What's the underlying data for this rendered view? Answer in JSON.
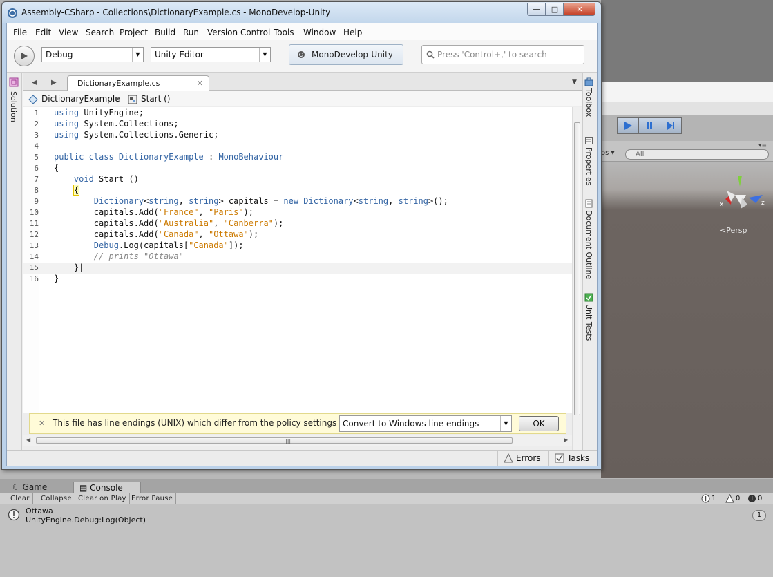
{
  "unity": {
    "scene": {
      "gizmo_dropdown": "os ▾",
      "search_placeholder": "All",
      "pane_menu": "▾≡",
      "persp_label": "Persp",
      "gizmo_axis_x": "x",
      "gizmo_axis_z": "z"
    },
    "play_controls": [
      "play",
      "pause",
      "step"
    ],
    "accent_color": "#3b78d6"
  },
  "console": {
    "tabs": [
      {
        "label": "Game",
        "icon": "game-icon"
      },
      {
        "label": "Console",
        "icon": "console-icon",
        "active": true
      }
    ],
    "buttons": [
      "Clear",
      "Collapse",
      "Clear on Play",
      "Error Pause"
    ],
    "counts": {
      "info": "1",
      "warning": "0",
      "error": "0"
    },
    "entries": [
      {
        "message": "Ottawa",
        "stack": "UnityEngine.Debug:Log(Object)",
        "count": "1"
      }
    ]
  },
  "monodevelop": {
    "window_title": "Assembly-CSharp - Collections\\DictionaryExample.cs - MonoDevelop-Unity",
    "window_buttons": {
      "minimize": "—",
      "maximize": "□",
      "close": "✕"
    },
    "menu": [
      "File",
      "Edit",
      "View",
      "Search",
      "Project",
      "Build",
      "Run",
      "Version Control",
      "Tools",
      "Window",
      "Help"
    ],
    "toolbar": {
      "configuration": "Debug",
      "target": "Unity Editor",
      "status": "MonoDevelop-Unity",
      "search_placeholder": "Press 'Control+,' to search"
    },
    "left_pads": [
      "Solution"
    ],
    "right_pads": [
      "Toolbox",
      "Properties",
      "Document Outline",
      "Unit Tests"
    ],
    "document_tab": {
      "title": "DictionaryExample.cs",
      "close": "✕"
    },
    "breadcrumb": {
      "class_name": "DictionaryExample",
      "method": "Start ()"
    },
    "code": {
      "current_line": 15,
      "lines": [
        [
          {
            "t": "kw",
            "v": "using"
          },
          {
            "t": "",
            "v": " UnityEngine;"
          }
        ],
        [
          {
            "t": "kw",
            "v": "using"
          },
          {
            "t": "",
            "v": " System.Collections;"
          }
        ],
        [
          {
            "t": "kw",
            "v": "using"
          },
          {
            "t": "",
            "v": " System.Collections.Generic;"
          }
        ],
        [],
        [
          {
            "t": "kw",
            "v": "public class"
          },
          {
            "t": "ty",
            "v": " DictionaryExample"
          },
          {
            "t": "",
            "v": " : "
          },
          {
            "t": "ty",
            "v": "MonoBehaviour"
          }
        ],
        [
          {
            "t": "",
            "v": "{"
          }
        ],
        [
          {
            "t": "kw",
            "v": "    void"
          },
          {
            "t": "",
            "v": " Start ()"
          }
        ],
        [
          {
            "t": "",
            "v": "    "
          },
          {
            "t": "br",
            "v": "{"
          }
        ],
        [
          {
            "t": "ty",
            "v": "        Dictionary"
          },
          {
            "t": "",
            "v": "<"
          },
          {
            "t": "kw",
            "v": "string"
          },
          {
            "t": "",
            "v": ", "
          },
          {
            "t": "kw",
            "v": "string"
          },
          {
            "t": "",
            "v": "> capitals = "
          },
          {
            "t": "kw",
            "v": "new"
          },
          {
            "t": "ty",
            "v": " Dictionary"
          },
          {
            "t": "",
            "v": "<"
          },
          {
            "t": "kw",
            "v": "string"
          },
          {
            "t": "",
            "v": ", "
          },
          {
            "t": "kw",
            "v": "string"
          },
          {
            "t": "",
            "v": ">();"
          }
        ],
        [
          {
            "t": "",
            "v": "        capitals.Add("
          },
          {
            "t": "st",
            "v": "\"France\""
          },
          {
            "t": "",
            "v": ", "
          },
          {
            "t": "st",
            "v": "\"Paris\""
          },
          {
            "t": "",
            "v": ");"
          }
        ],
        [
          {
            "t": "",
            "v": "        capitals.Add("
          },
          {
            "t": "st",
            "v": "\"Australia\""
          },
          {
            "t": "",
            "v": ", "
          },
          {
            "t": "st",
            "v": "\"Canberra\""
          },
          {
            "t": "",
            "v": ");"
          }
        ],
        [
          {
            "t": "",
            "v": "        capitals.Add("
          },
          {
            "t": "st",
            "v": "\"Canada\""
          },
          {
            "t": "",
            "v": ", "
          },
          {
            "t": "st",
            "v": "\"Ottawa\""
          },
          {
            "t": "",
            "v": ");"
          }
        ],
        [
          {
            "t": "ty",
            "v": "        Debug"
          },
          {
            "t": "",
            "v": ".Log(capitals["
          },
          {
            "t": "st",
            "v": "\"Canada\""
          },
          {
            "t": "",
            "v": "]);"
          }
        ],
        [
          {
            "t": "cm",
            "v": "        // prints \"Ottawa\""
          }
        ],
        [
          {
            "t": "",
            "v": "    }|"
          }
        ],
        [
          {
            "t": "",
            "v": "}"
          }
        ]
      ]
    },
    "infobar": {
      "close": "✕",
      "message": "This file has line endings (UNIX) which differ from the policy settings (Wind...",
      "action": "Convert to Windows line endings",
      "ok": "OK"
    },
    "statusbar": {
      "errors": "Errors",
      "tasks": "Tasks"
    }
  }
}
